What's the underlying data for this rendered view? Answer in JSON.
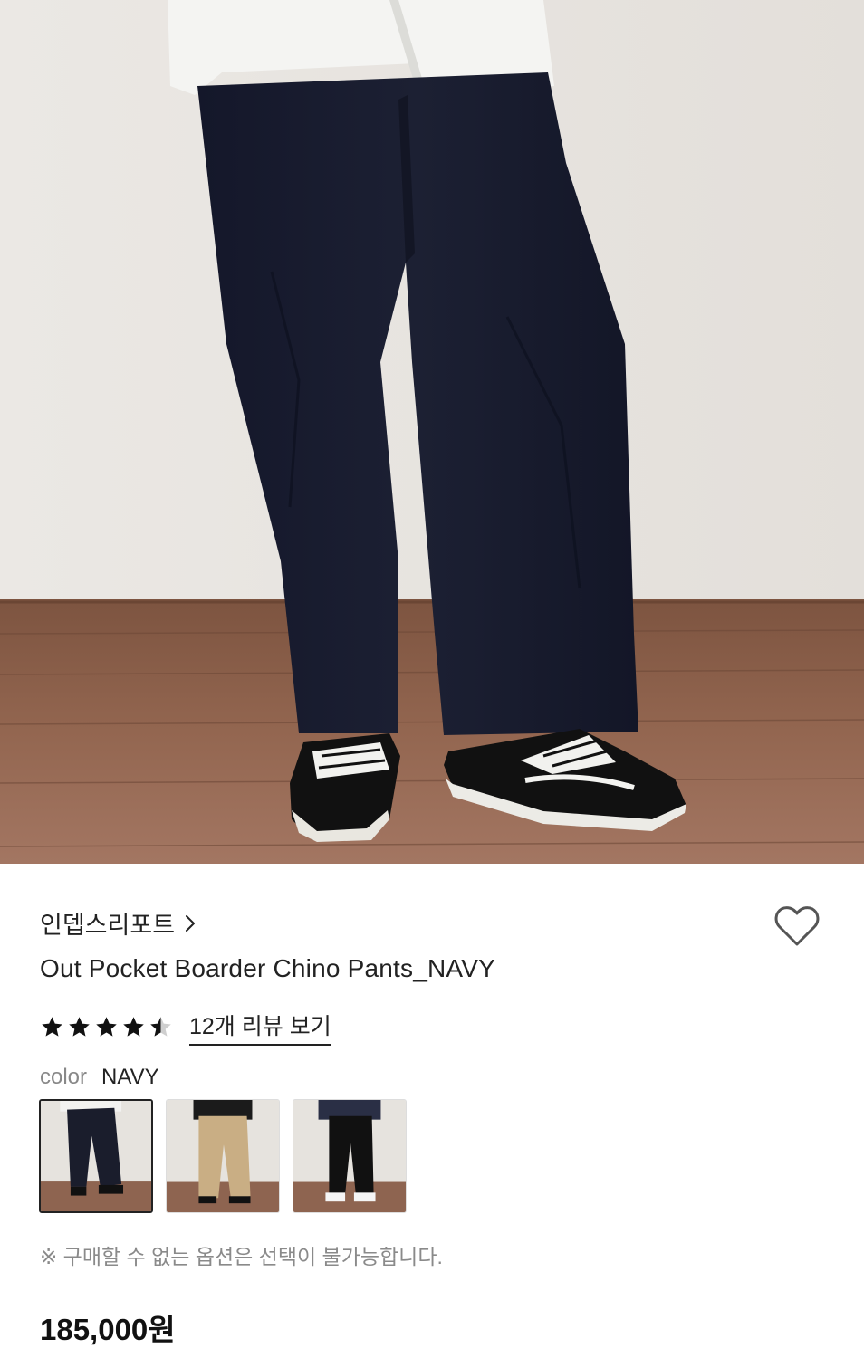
{
  "product": {
    "brand": "인뎁스리포트",
    "name": "Out Pocket Boarder Chino Pants_NAVY",
    "rating": 4.5,
    "rating_max": 5,
    "review_link": "12개 리뷰 보기",
    "color_label": "color",
    "color_value": "NAVY",
    "swatches": [
      {
        "name": "navy",
        "color": "#1a1d2c"
      },
      {
        "name": "beige",
        "color": "#c9ae84"
      },
      {
        "name": "black",
        "color": "#111111"
      }
    ],
    "notice": "※ 구매할 수 없는 옵션은 선택이 불가능합니다.",
    "price": "185,000원"
  },
  "icons": {
    "brand_chevron": "chevron-right-icon",
    "wishlist": "heart-outline-icon",
    "star": "star-icon"
  },
  "colors": {
    "pants_navy": "#181b2a",
    "wall": "#e8e4df",
    "floor": "#8a5e45",
    "text_primary": "#222222",
    "text_muted": "#888888"
  }
}
